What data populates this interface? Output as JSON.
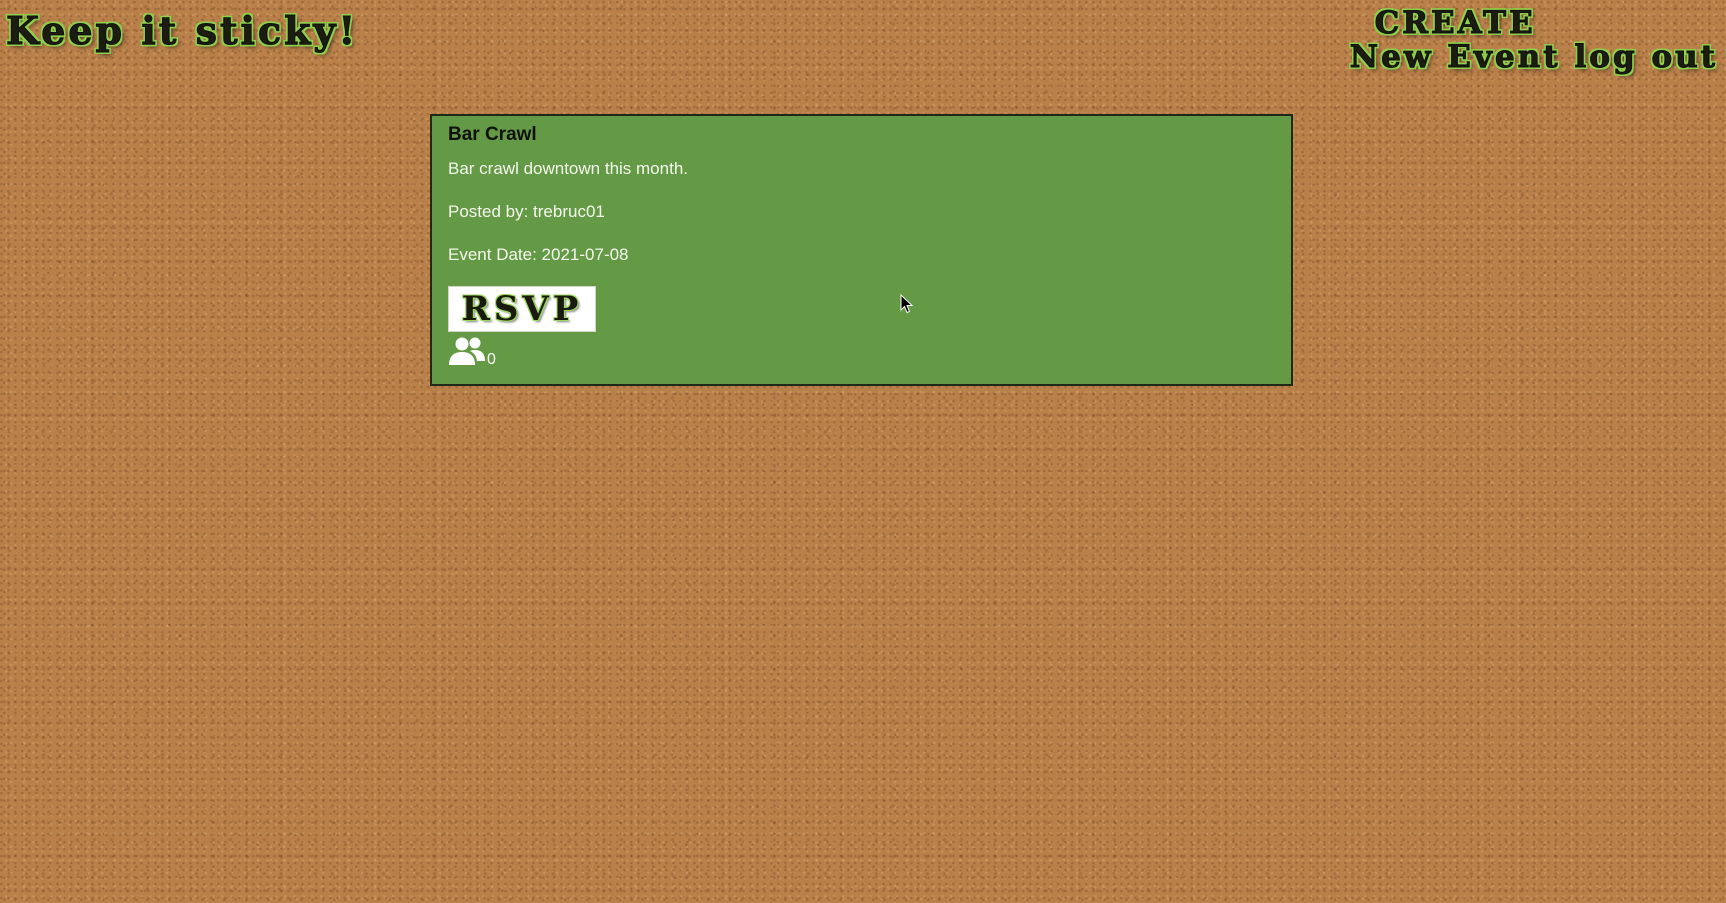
{
  "header": {
    "site_title": "Keep it sticky!",
    "create_line1": "CREATE",
    "create_line2": "New Event",
    "logout_label": "log out"
  },
  "event": {
    "title": "Bar Crawl",
    "description": "Bar crawl downtown this month.",
    "posted_by": "Posted by: trebruc01",
    "event_date": "Event Date: 2021-07-08",
    "rsvp_label": "RSVP",
    "attendee_icon": "users-icon",
    "attendee_count": "0"
  },
  "colors": {
    "background": "#b9804a",
    "card": "#649a45",
    "accent": "#8fd04a"
  }
}
